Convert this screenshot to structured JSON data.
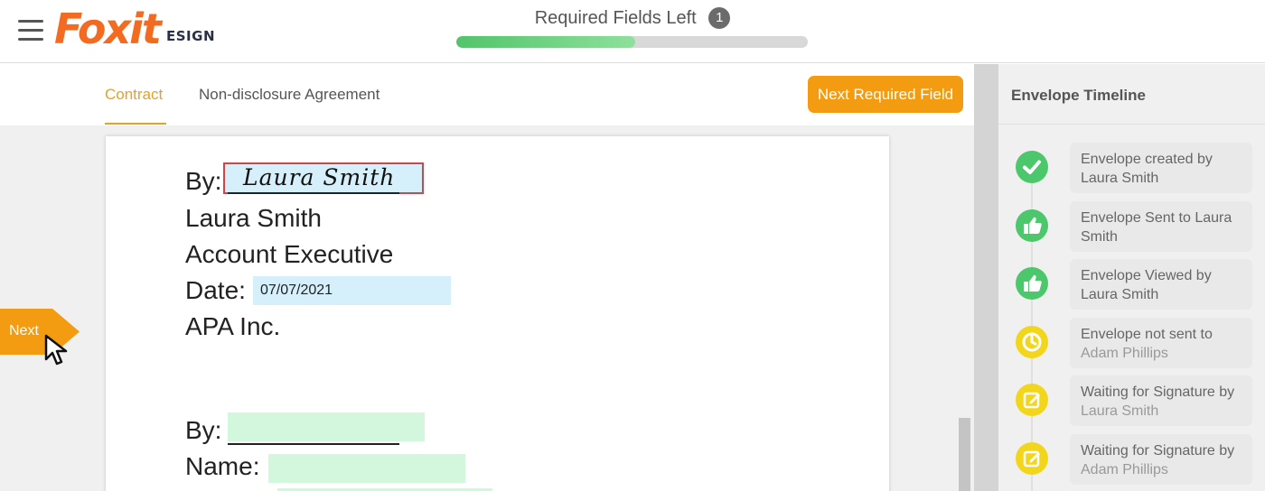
{
  "app": {
    "logo": "Foxit",
    "logo_sub": "ESIGN"
  },
  "progress": {
    "label": "Required Fields Left",
    "count": "1",
    "fraction": 0.51
  },
  "tabs": [
    {
      "label": "Contract",
      "active": true
    },
    {
      "label": "Non-disclosure Agreement",
      "active": false
    }
  ],
  "actions": {
    "next_required": "Next Required Field",
    "next_flag": "Next"
  },
  "document": {
    "by_label": "By:",
    "signature": "Laura Smith",
    "name": "Laura Smith",
    "title": "Account Executive",
    "date_label": "Date:",
    "date_value": "07/07/2021",
    "company": "APA Inc.",
    "by2_label": "By:",
    "name2_label": "Name:"
  },
  "sidebar": {
    "title": "Envelope Timeline",
    "items": [
      {
        "icon": "check-icon",
        "color": "#4cc76c",
        "text": "Envelope created by",
        "sub": "Laura Smith",
        "sub_muted": false
      },
      {
        "icon": "thumbs-up-icon",
        "color": "#4cc76c",
        "text": "Envelope Sent to Laura",
        "sub": "Smith",
        "sub_muted": false
      },
      {
        "icon": "thumbs-up-icon",
        "color": "#4cc76c",
        "text": "Envelope Viewed by",
        "sub": "Laura Smith",
        "sub_muted": false
      },
      {
        "icon": "clock-icon",
        "color": "#f2d61c",
        "text": "Envelope not sent to",
        "sub": "Adam Phillips",
        "sub_muted": true
      },
      {
        "icon": "edit-icon",
        "color": "#f2d61c",
        "text": "Waiting for Signature by",
        "sub": "Laura Smith",
        "sub_muted": true
      },
      {
        "icon": "edit-icon",
        "color": "#f2d61c",
        "text": "Waiting for Signature by",
        "sub": "Adam Phillips",
        "sub_muted": true
      }
    ]
  }
}
